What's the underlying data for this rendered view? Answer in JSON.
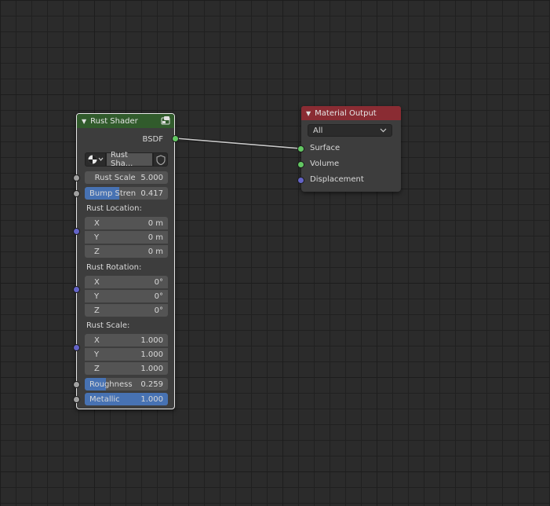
{
  "rust_node": {
    "title": "Rust Shader",
    "output_label": "BSDF",
    "datablock_name": "Rust Sha...",
    "fields": {
      "rust_scale": {
        "label": "Rust Scale",
        "value": "5.000"
      },
      "bump_strength": {
        "label": "Bump Stren",
        "value": "0.417",
        "fill": 0.417
      }
    },
    "rust_location": {
      "label": "Rust Location:",
      "x": {
        "label": "X",
        "value": "0 m"
      },
      "y": {
        "label": "Y",
        "value": "0 m"
      },
      "z": {
        "label": "Z",
        "value": "0 m"
      }
    },
    "rust_rotation": {
      "label": "Rust Rotation:",
      "x": {
        "label": "X",
        "value": "0°"
      },
      "y": {
        "label": "Y",
        "value": "0°"
      },
      "z": {
        "label": "Z",
        "value": "0°"
      }
    },
    "rust_scale_vec": {
      "label": "Rust Scale:",
      "x": {
        "label": "X",
        "value": "1.000"
      },
      "y": {
        "label": "Y",
        "value": "1.000"
      },
      "z": {
        "label": "Z",
        "value": "1.000"
      }
    },
    "roughness": {
      "label": "Roughness",
      "value": "0.259",
      "fill": 0.259
    },
    "metallic": {
      "label": "Metallic",
      "value": "1.000",
      "fill": 1.0
    }
  },
  "material_output": {
    "title": "Material Output",
    "target": "All",
    "inputs": {
      "surface": "Surface",
      "volume": "Volume",
      "displacement": "Displacement"
    }
  },
  "colors": {
    "rust_header": "#315b2c",
    "output_header": "#8a2c33",
    "socket_shader": "#63c763",
    "socket_float": "#a1a1a1",
    "socket_vector": "#6363c7",
    "slider_fill": "#4772b3"
  },
  "icons": {
    "rust_header_icon": "node-group-icon",
    "browse_icon": "material-sphere-icon",
    "fake_user_icon": "shield-icon"
  }
}
